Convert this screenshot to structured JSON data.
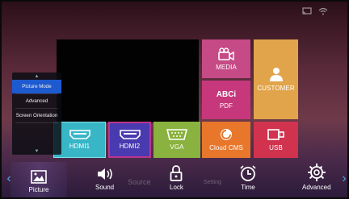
{
  "status_icons": [
    "cast-icon",
    "wifi-icon"
  ],
  "preview": {
    "color": "#020202"
  },
  "tiles": {
    "media": {
      "label": "MEDIA",
      "icon": "video-camera-icon",
      "color": "#c64a86"
    },
    "pdf": {
      "label": "PDF",
      "abc": "ABCi",
      "icon": "text-icon",
      "color": "#c6387b"
    },
    "customer": {
      "label": "CUSTOMER",
      "icon": "person-icon",
      "color": "#e2a44a"
    },
    "hdmi1": {
      "label": "HDMI1",
      "icon": "hdmi-icon",
      "color": "#38b6c6"
    },
    "hdmi2": {
      "label": "HDMI2",
      "icon": "hdmi-icon",
      "color": "#4a3ab0"
    },
    "vga": {
      "label": "VGA",
      "icon": "vga-icon",
      "color": "#8ab23e"
    },
    "cloud_cms": {
      "label": "Cloud CMS",
      "icon": "cloud-cms-icon",
      "color": "#e8772c"
    },
    "usb": {
      "label": "USB",
      "icon": "usb-icon",
      "color": "#d1324e"
    }
  },
  "submenu": {
    "items": [
      "Picture Mode",
      "Advanced",
      "Screen Orientation"
    ],
    "selected": "Picture Mode",
    "selected_color": "#1d5ad0"
  },
  "bottom_bar": {
    "ghost_labels": [
      "Source",
      "Setting"
    ],
    "items": [
      {
        "label": "Picture",
        "icon": "picture-icon"
      },
      {
        "label": "Sound",
        "icon": "speaker-icon"
      },
      {
        "label": "Lock",
        "icon": "lock-icon"
      },
      {
        "label": "Time",
        "icon": "clock-icon"
      },
      {
        "label": "Advanced",
        "icon": "gear-icon"
      }
    ],
    "selected": "Picture",
    "arrow_color": "#4ea8e8"
  }
}
